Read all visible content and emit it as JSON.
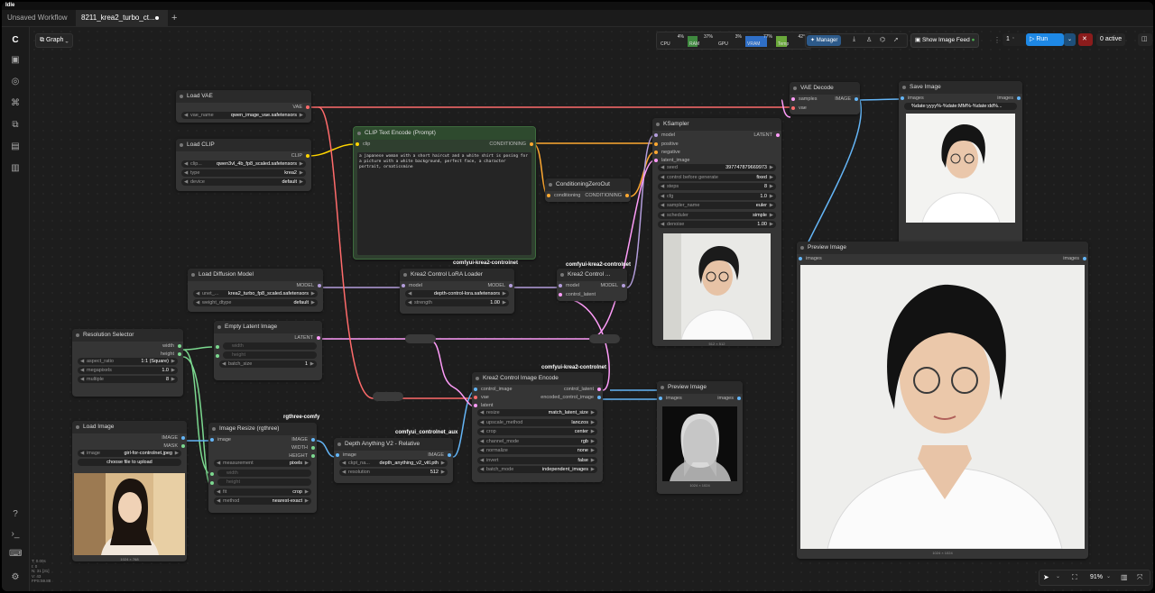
{
  "titlebar": {
    "label": "Idle"
  },
  "tabs": [
    {
      "label": "Unsaved Workflow"
    },
    {
      "label": "8211_krea2_turbo_ct..."
    }
  ],
  "toolbar": {
    "graph_label": "Graph",
    "stats": [
      {
        "name": "CPU",
        "value": "4%"
      },
      {
        "name": "RAM",
        "value": "37%"
      },
      {
        "name": "GPU",
        "value": "3%"
      },
      {
        "name": "VRAM",
        "value": "77%"
      },
      {
        "name": "Temp",
        "value": "42°"
      }
    ],
    "manager_label": "Manager",
    "show_image_feed_label": "Show Image Feed",
    "queue_count": "1",
    "run_label": "Run",
    "active_label": "0 active"
  },
  "status": {
    "lines": [
      "T: 0.00s",
      "I: 0",
      "N: 31 [31]",
      "V: 43",
      "FPS:59.88"
    ]
  },
  "bottom": {
    "zoom": "91%"
  },
  "groups": {
    "g1": "comfyui-krea2-controlnet",
    "g2": "comfyui-krea2-controlnet",
    "g3": "comfyui-krea2-controlnet",
    "g4": "comfyui_controlnet_aux",
    "g5": "rgthree-comfy"
  },
  "nodes": {
    "load_vae": {
      "title": "Load VAE",
      "out": "VAE",
      "w1l": "vae_name",
      "w1v": "qwen_image_vae.safetensors"
    },
    "load_clip": {
      "title": "Load CLIP",
      "out": "CLIP",
      "w1l": "clip...",
      "w1v": "qwen3vl_4b_fp8_scaled.safetensors",
      "w2l": "type",
      "w2v": "krea2",
      "w3l": "device",
      "w3v": "default"
    },
    "clip_text": {
      "title": "CLIP Text Encode (Prompt)",
      "in": "clip",
      "out": "CONDITIONING",
      "text": "a japanese woman with a short haircut and a white shirt is posing for a picture with a white background, perfect face, a character portrait, ornaticsmine"
    },
    "cond_zero": {
      "title": "ConditioningZeroOut",
      "in": "conditioning",
      "out": "CONDITIONING"
    },
    "ksampler": {
      "title": "KSampler",
      "in1": "model",
      "in2": "positive",
      "in3": "negative",
      "in4": "latent_image",
      "out": "LATENT",
      "w": [
        {
          "l": "seed",
          "v": "397747879669973"
        },
        {
          "l": "control before generate",
          "v": "fixed"
        },
        {
          "l": "steps",
          "v": "8"
        },
        {
          "l": "cfg",
          "v": "1.0"
        },
        {
          "l": "sampler_name",
          "v": "euler"
        },
        {
          "l": "scheduler",
          "v": "simple"
        },
        {
          "l": "denoise",
          "v": "1.00"
        }
      ],
      "cap": "512 × 512"
    },
    "vae_decode": {
      "title": "VAE Decode",
      "in1": "samples",
      "in2": "vae",
      "out": "IMAGE"
    },
    "save_image": {
      "title": "Save Image",
      "in": "images",
      "out": "images",
      "w1": "%date:yyyy%-%date:MM%-%date:dd%...",
      "cap": "1024 × 1024"
    },
    "preview_big": {
      "title": "Preview Image",
      "in": "images",
      "out": "images",
      "cap": "1024 × 1024"
    },
    "load_diff": {
      "title": "Load Diffusion Model",
      "out": "MODEL",
      "w1l": "unet_...",
      "w1v": "krea2_turbo_fp8_scaled.safetensors",
      "w2l": "weight_dtype",
      "w2v": "default"
    },
    "lora": {
      "title": "Krea2 Control LoRA Loader",
      "in": "model",
      "out": "MODEL",
      "w1v": "depth-control-lora.safetensors",
      "w2l": "strength",
      "w2v": "1.00"
    },
    "krea_ctrl": {
      "title": "Krea2 Control ...",
      "in1": "model",
      "in2": "control_latent",
      "out": "MODEL"
    },
    "res_sel": {
      "title": "Resolution Selector",
      "out1": "width",
      "out2": "height",
      "w": [
        {
          "l": "aspect_ratio",
          "v": "1:1 (Square)"
        },
        {
          "l": "megapixels",
          "v": "1.0"
        },
        {
          "l": "multiple",
          "v": "8"
        }
      ]
    },
    "empty_latent": {
      "title": "Empty Latent Image",
      "out": "LATENT",
      "w1": "width",
      "w2": "height",
      "w3l": "batch_size",
      "w3v": "1"
    },
    "ctrl_enc": {
      "title": "Krea2 Control Image Encode",
      "in1": "control_image",
      "in2": "vae",
      "in3": "latent",
      "out1": "control_latent",
      "out2": "encoded_control_image",
      "w": [
        {
          "l": "resize",
          "v": "match_latent_size"
        },
        {
          "l": "upscale_method",
          "v": "lanczos"
        },
        {
          "l": "crop",
          "v": "center"
        },
        {
          "l": "channel_mode",
          "v": "rgb"
        },
        {
          "l": "normalize",
          "v": "none"
        },
        {
          "l": "invert",
          "v": "false"
        },
        {
          "l": "batch_mode",
          "v": "independent_images"
        }
      ]
    },
    "preview_small": {
      "title": "Preview Image",
      "in": "images",
      "out": "images",
      "cap": "1024 × 1024"
    },
    "load_image": {
      "title": "Load Image",
      "out1": "IMAGE",
      "out2": "MASK",
      "w1l": "image",
      "w1v": "girl-for-controlnet.jpeg",
      "upload": "choose file to upload",
      "cap": "1024 × 768"
    },
    "img_resize": {
      "title": "Image Resize (rgthree)",
      "in": "image",
      "out1": "IMAGE",
      "out2": "WIDTH",
      "out3": "HEIGHT",
      "w": [
        {
          "l": "measurement",
          "v": "pixels"
        },
        {
          "l": "width",
          "v": ""
        },
        {
          "l": "height",
          "v": ""
        },
        {
          "l": "fit",
          "v": "crop"
        },
        {
          "l": "method",
          "v": "nearest-exact"
        }
      ]
    },
    "depth": {
      "title": "Depth Anything V2 - Relative",
      "in": "image",
      "out": "IMAGE",
      "w1l": "ckpt_na...",
      "w1v": "depth_anything_v2_vitl.pth",
      "w2l": "resolution",
      "w2v": "512"
    }
  }
}
